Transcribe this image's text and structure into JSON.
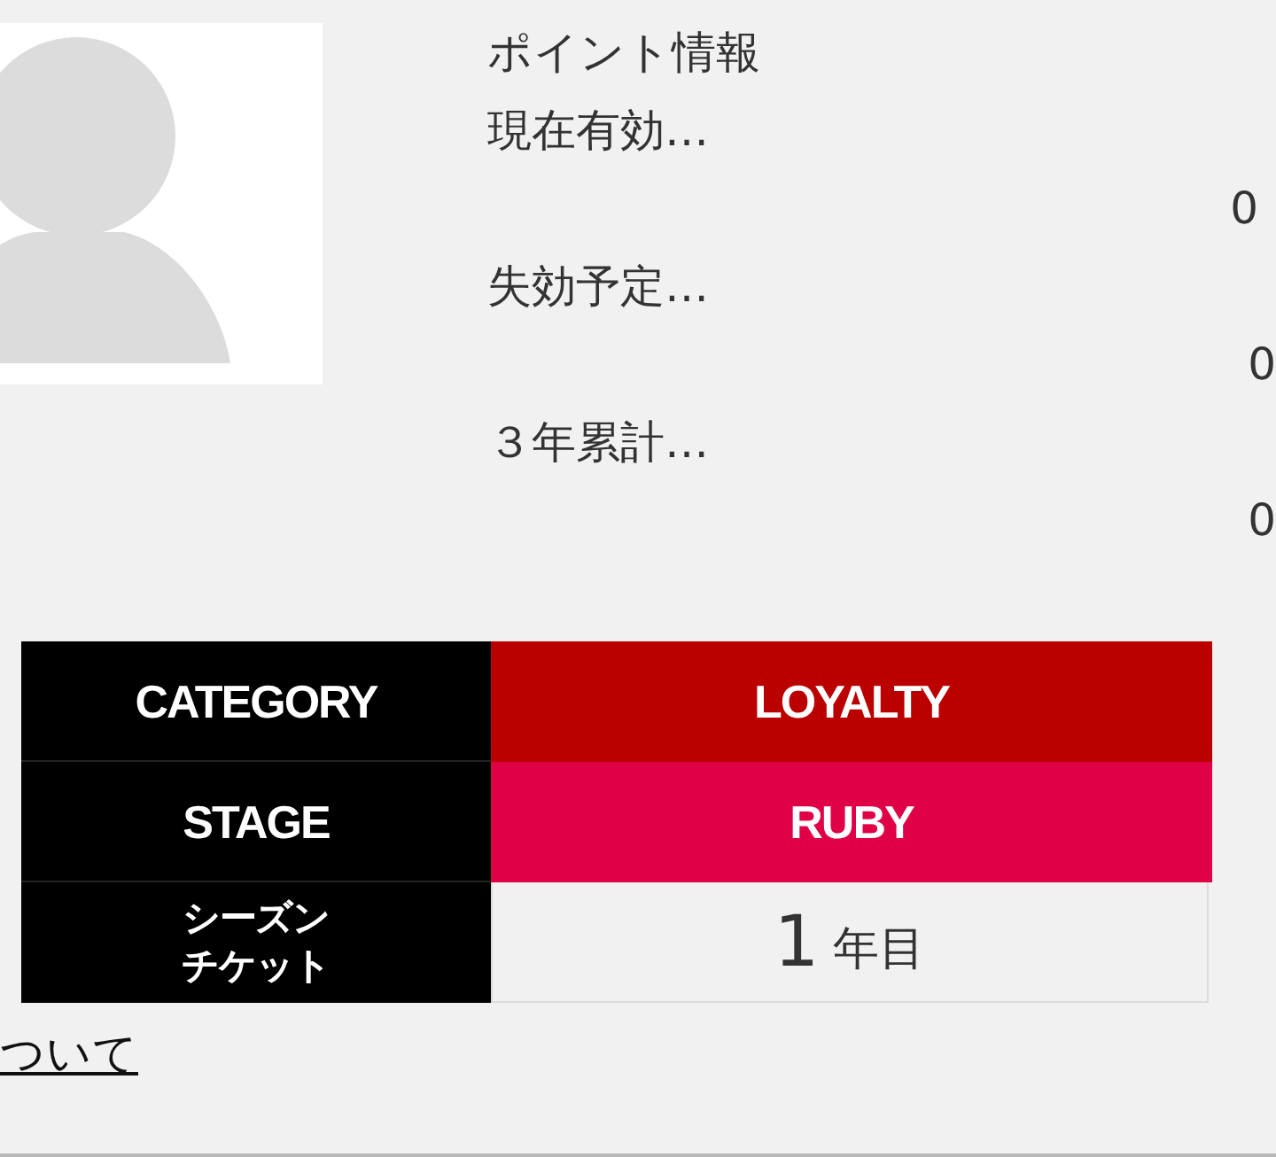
{
  "points": {
    "title": "ポイント情報",
    "items": [
      {
        "label": "現在有効…",
        "value": "0"
      },
      {
        "label": "失効予定…",
        "value": "0"
      },
      {
        "label": "３年累計…",
        "value": "0"
      }
    ]
  },
  "status_table": {
    "rows": [
      {
        "kind": "badge",
        "label": "CATEGORY",
        "value": "LOYALTY",
        "color": "#bb0000"
      },
      {
        "kind": "badge",
        "label": "STAGE",
        "value": "RUBY",
        "color": "#e00046"
      },
      {
        "kind": "years",
        "label": "シーズンチケット",
        "value": "1",
        "unit": "年目"
      }
    ]
  },
  "link": "ついて"
}
